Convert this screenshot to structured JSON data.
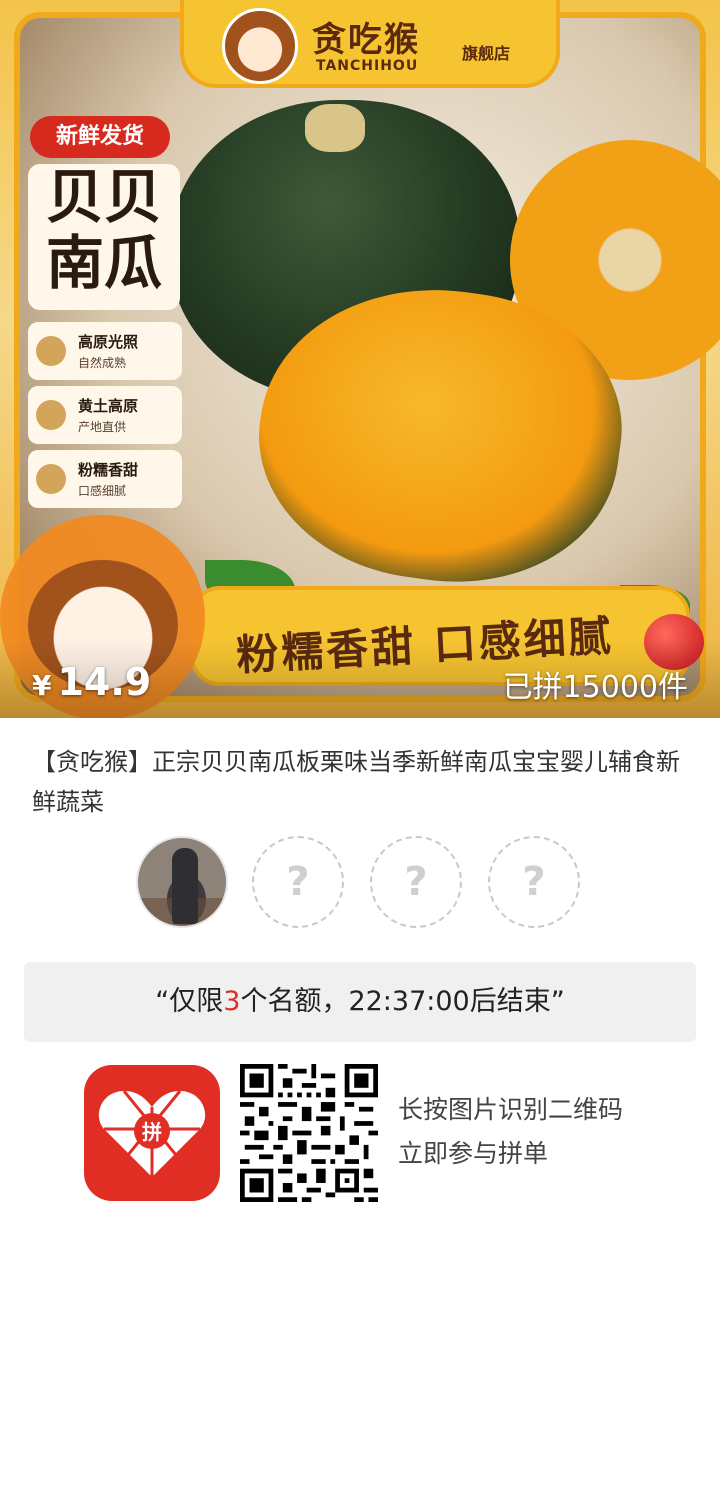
{
  "hero": {
    "brand_name": "贪吃猴",
    "brand_pinyin": "TANCHIHOU",
    "brand_store": "旗舰店",
    "fresh_tag": "新鲜发货",
    "title_line1": "贝贝",
    "title_line2": "南瓜",
    "features": [
      {
        "title": "高原光照",
        "subtitle": "自然成熟"
      },
      {
        "title": "黄土高原",
        "subtitle": "产地直供"
      },
      {
        "title": "粉糯香甜",
        "subtitle": "口感细腻"
      }
    ],
    "slogan": "粉糯香甜 口感细腻",
    "price_currency": "¥",
    "price_amount": "14.9",
    "sold_text": "已拼15000件"
  },
  "product": {
    "title": "【贪吃猴】正宗贝贝南瓜板栗味当季新鲜南瓜宝宝婴儿辅食新鲜蔬菜"
  },
  "group": {
    "empty_slot_symbol": "?",
    "limit_prefix": "“仅限",
    "limit_count": "3",
    "limit_suffix": "个名额，22:37:00后结束”"
  },
  "share": {
    "app_icon_text": "拼",
    "qr_hint_line1": "长按图片识别二维码",
    "qr_hint_line2": "立即参与拼单"
  },
  "colors": {
    "accent_red": "#e02e24",
    "pdd_red": "#e02e24",
    "banner_yellow": "#f7c431"
  }
}
